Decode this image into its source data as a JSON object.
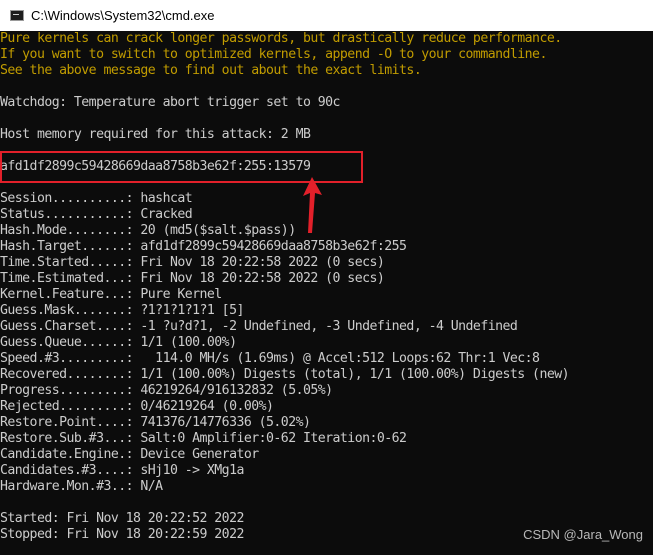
{
  "window": {
    "title": "C:\\Windows\\System32\\cmd.exe",
    "icon": "cmd-console-icon"
  },
  "console": {
    "warning_lines": [
      "Pure kernels can crack longer passwords, but drastically reduce performance.",
      "If you want to switch to optimized kernels, append -O to your commandline.",
      "See the above message to find out about the exact limits."
    ],
    "watchdog": "Watchdog: Temperature abort trigger set to 90c",
    "host_memory": "Host memory required for this attack: 2 MB",
    "cracked_result": "afd1df2899c59428669daa8758b3e62f:255:13579",
    "status_lines": [
      "Session..........: hashcat",
      "Status...........: Cracked",
      "Hash.Mode........: 20 (md5($salt.$pass))",
      "Hash.Target......: afd1df2899c59428669daa8758b3e62f:255",
      "Time.Started.....: Fri Nov 18 20:22:58 2022 (0 secs)",
      "Time.Estimated...: Fri Nov 18 20:22:58 2022 (0 secs)",
      "Kernel.Feature...: Pure Kernel",
      "Guess.Mask.......: ?1?1?1?1?1 [5]",
      "Guess.Charset....: -1 ?u?d?1, -2 Undefined, -3 Undefined, -4 Undefined",
      "Guess.Queue......: 1/1 (100.00%)",
      "Speed.#3.........:   114.0 MH/s (1.69ms) @ Accel:512 Loops:62 Thr:1 Vec:8",
      "Recovered........: 1/1 (100.00%) Digests (total), 1/1 (100.00%) Digests (new)",
      "Progress.........: 46219264/916132832 (5.05%)",
      "Rejected.........: 0/46219264 (0.00%)",
      "Restore.Point....: 741376/14776336 (5.02%)",
      "Restore.Sub.#3...: Salt:0 Amplifier:0-62 Iteration:0-62",
      "Candidate.Engine.: Device Generator",
      "Candidates.#3....: sHj10 -> XMg1a",
      "Hardware.Mon.#3..: N/A"
    ],
    "started": "Started: Fri Nov 18 20:22:52 2022",
    "stopped": "Stopped: Fri Nov 18 20:22:59 2022"
  },
  "annotation": {
    "highlight_color": "#e3202a",
    "arrow": "red-arrow-pointing-up"
  },
  "watermark": "CSDN @Jara_Wong"
}
